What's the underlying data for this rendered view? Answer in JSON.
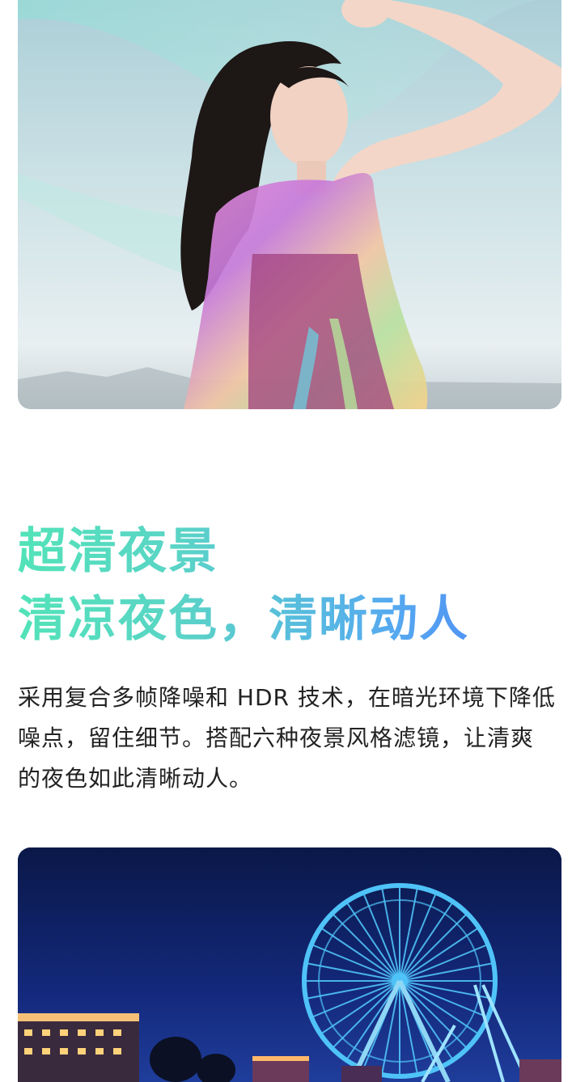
{
  "feature": {
    "headline": "超清夜景",
    "subheadline": "清凉夜色，清晰动人",
    "description": "采用复合多帧降噪和 HDR 技术，在暗光环境下降低噪点，留住细节。搭配六种夜景风格滤镜，让清爽的夜色如此清晰动人。",
    "gradient_colors": [
      "#52e3b8",
      "#4b7cf7"
    ]
  },
  "images": {
    "top": "portrait-photo",
    "bottom": "night-ferris-wheel-photo"
  }
}
